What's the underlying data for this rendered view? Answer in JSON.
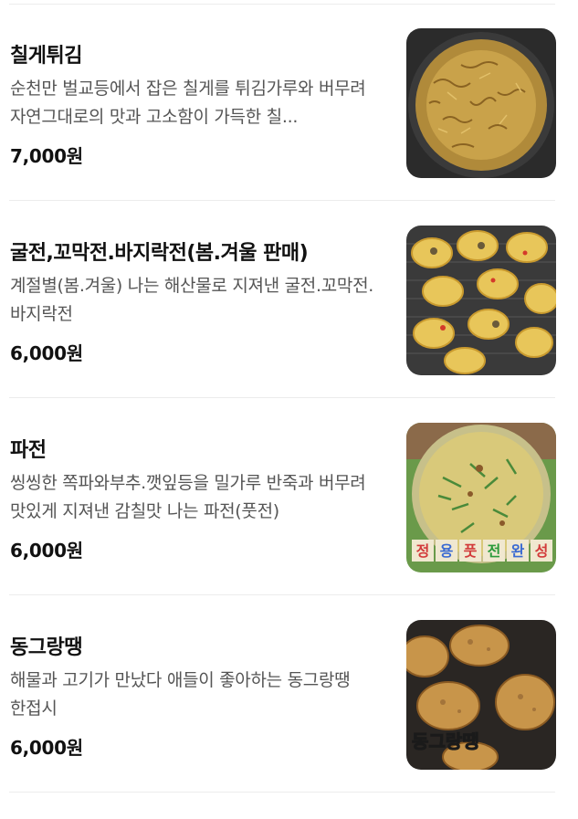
{
  "menu": {
    "items": [
      {
        "name": "칠게튀김",
        "description": "순천만 벌교등에서 잡은 칠게를 튀김가루와 버무려 자연그대로의 맛과 고소함이 가득한 칠...",
        "price": "7,000원",
        "image_icon": "fried-crab-photo"
      },
      {
        "name": "굴전,꼬막전.바지락전(봄.겨울 판매)",
        "description": "계절별(봄.겨울) 나는 해산물로 지져낸 굴전.꼬막전.바지락전",
        "price": "6,000원",
        "image_icon": "seafood-jeon-photo"
      },
      {
        "name": "파전",
        "description": "씽씽한 쪽파와부추.깻잎등을 밀가루 반죽과 버무려 맛있게 지져낸 감칠맛 나는 파전(풋전)",
        "price": "6,000원",
        "image_icon": "pajeon-photo",
        "image_caption": [
          "정",
          "용",
          "풋",
          "전",
          "완",
          "성"
        ]
      },
      {
        "name": "동그랑땡",
        "description": "해물과 고기가 만났다 애들이 좋아하는 동그랑땡 한접시",
        "price": "6,000원",
        "image_icon": "meat-patty-photo",
        "image_caption": "동그랑땡"
      }
    ]
  }
}
